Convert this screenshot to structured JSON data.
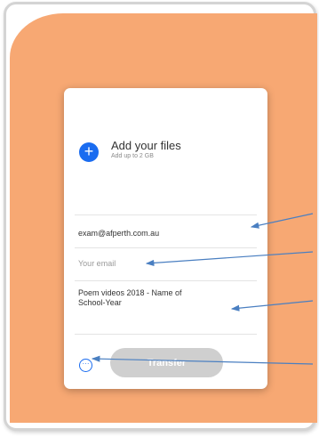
{
  "card": {
    "add_icon": "+",
    "title": "Add your files",
    "subtitle": "Add up to 2 GB",
    "email_to_value": "exam@afperth.com.au",
    "your_email_placeholder": "Your email",
    "message_value": "Poem videos 2018 - Name of School-Year",
    "more_options_icon": "···",
    "transfer_label": "Transfer"
  },
  "colors": {
    "background_accent": "#f7a873",
    "primary": "#1a6cf0",
    "arrow": "#4a7fc1",
    "transfer_disabled": "#cfcfcf"
  }
}
